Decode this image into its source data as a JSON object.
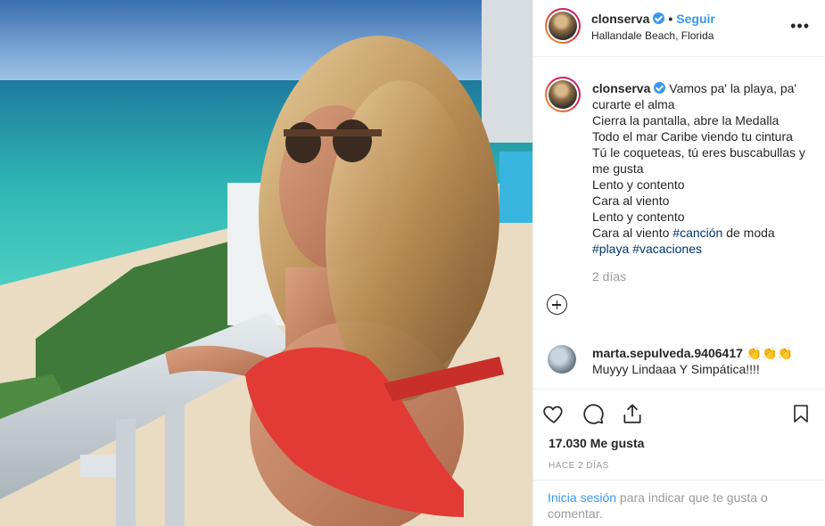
{
  "post": {
    "username": "clonserva",
    "follow_label": "Seguir",
    "location": "Hallandale Beach, Florida",
    "more_label": "•••",
    "caption_lines": [
      "Vamos pa' la playa, pa' curarte el alma",
      "Cierra la pantalla, abre la Medalla",
      "Todo el mar Caribe viendo tu cintura",
      "Tú le coqueteas, tú eres buscabullas y me gusta",
      "Lento y contento",
      "Cara al viento",
      "Lento y contento"
    ],
    "caption_last_prefix": "Cara al viento ",
    "hashtag_cancion": "#canción",
    "caption_last_suffix": " de moda",
    "hashtag_playa": "#playa",
    "hashtag_vacaciones": "#vacaciones",
    "caption_time": "2 días"
  },
  "comment": {
    "username": "marta.sepulveda.9406417",
    "emoji": "👏👏👏",
    "text": "Muyyy Lindaaa Y Simpática!!!!"
  },
  "footer": {
    "likes": "17.030 Me gusta",
    "date": "HACE 2 DÍAS",
    "login_link": "Inicia sesión",
    "login_text": " para indicar que te gusta o comentar."
  },
  "icons": [
    "heart-icon",
    "comment-icon",
    "share-icon",
    "bookmark-icon",
    "add-comment-icon",
    "verified-icon",
    "more-options-icon"
  ],
  "colors": {
    "link": "#3897f0",
    "hashtag": "#003569",
    "muted": "#999999",
    "verified": "#3897f0"
  }
}
